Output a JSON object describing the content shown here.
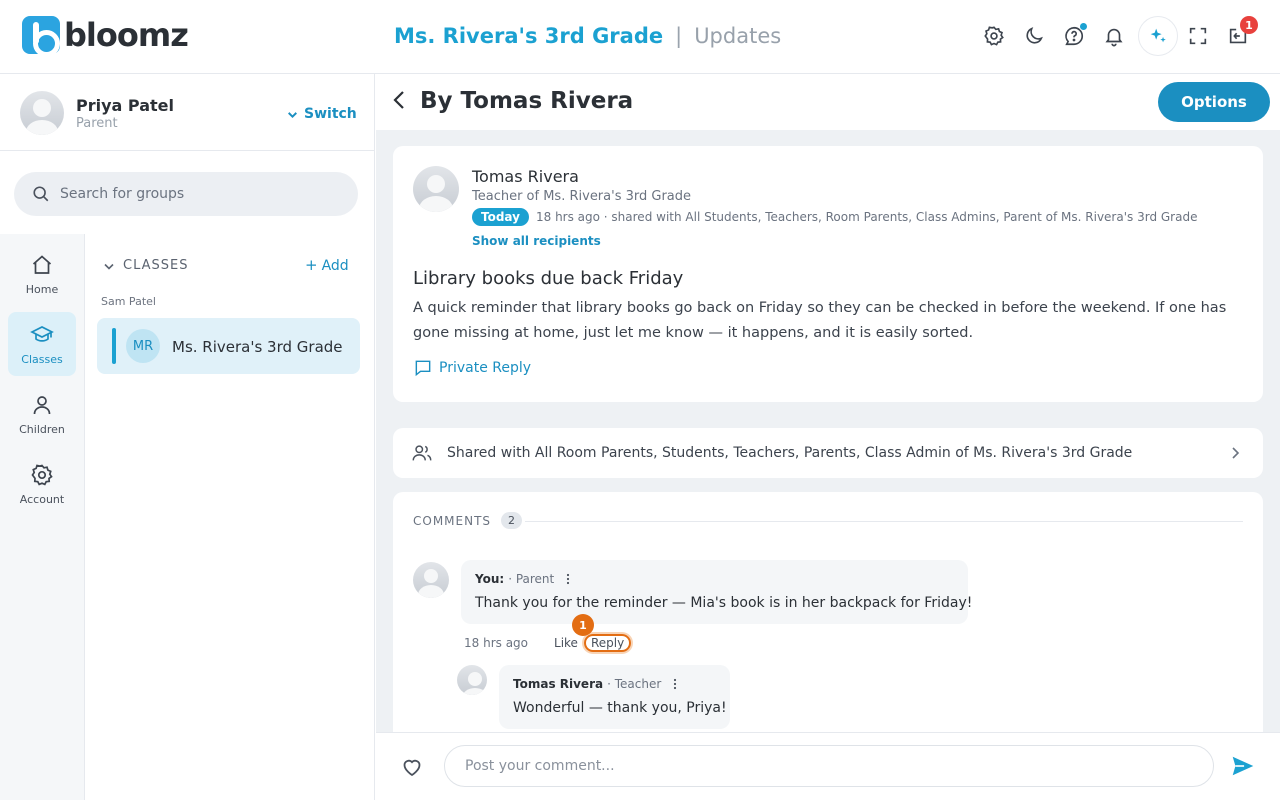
{
  "app": {
    "name": "bloomz"
  },
  "header": {
    "class_name": "Ms. Rivera's 3rd Grade",
    "separator": "|",
    "section": "Updates",
    "notifications_badge": "1"
  },
  "user": {
    "name": "Priya Patel",
    "role": "Parent",
    "switch_label": "Switch"
  },
  "search": {
    "placeholder": "Search for groups"
  },
  "nav": [
    {
      "label": "Home",
      "icon": "home-icon"
    },
    {
      "label": "Classes",
      "icon": "classes-icon",
      "active": true
    },
    {
      "label": "Children",
      "icon": "person-icon"
    },
    {
      "label": "Account",
      "icon": "gear-icon"
    }
  ],
  "classes": {
    "heading": "CLASSES",
    "add_label": "Add",
    "owner": "Sam Patel",
    "items": [
      {
        "initials": "MR",
        "name": "Ms. Rivera's 3rd Grade"
      }
    ]
  },
  "content": {
    "title": "By Tomas Rivera",
    "options_label": "Options"
  },
  "post": {
    "author": "Tomas Rivera",
    "author_subtitle": "Teacher of Ms. Rivera's 3rd Grade",
    "day_badge": "Today",
    "meta": "18 hrs ago · shared with All Students, Teachers, Room Parents, Class Admins, Parent of Ms. Rivera's 3rd Grade",
    "show_recipients": "Show all recipients",
    "title": "Library books due back Friday",
    "body": "A quick reminder that library books go back on Friday so they can be checked in before the weekend. If one has gone missing at home, just let me know — it happens, and it is easily sorted.",
    "private_reply": "Private Reply"
  },
  "shared": {
    "text": "Shared with All Room Parents, Students, Teachers, Parents, Class Admin of Ms. Rivera's 3rd Grade"
  },
  "comments": {
    "heading": "COMMENTS",
    "count": "2",
    "items": [
      {
        "author": "You:",
        "role": "· Parent",
        "text": "Thank you for the reminder — Mia's book is in her backpack for Friday!",
        "time": "18 hrs ago",
        "like": "Like",
        "reply": "Reply",
        "step_marker": "1"
      },
      {
        "author": "Tomas Rivera",
        "role": "· Teacher",
        "text": "Wonderful — thank you, Priya!"
      }
    ]
  },
  "composer": {
    "placeholder": "Post your comment..."
  },
  "colors": {
    "accent": "#1ba1d1",
    "button": "#1b8fc1",
    "highlight": "#e36d13",
    "badge": "#e8413d"
  }
}
